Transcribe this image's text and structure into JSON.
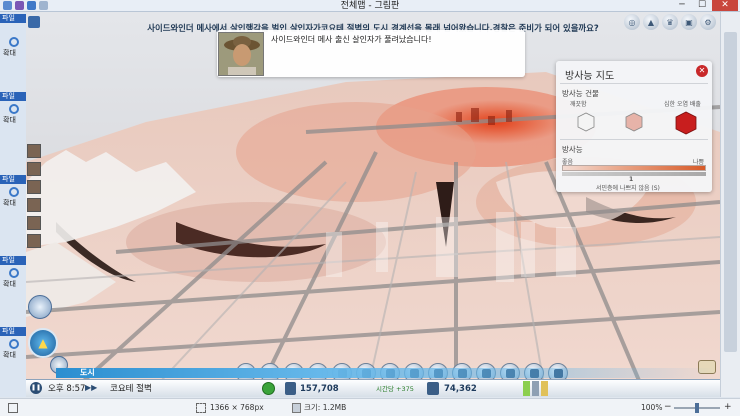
{
  "window": {
    "title": "전체맵 - 그림판",
    "controls": {
      "minimize": "─",
      "maximize": "☐",
      "close": "✕"
    }
  },
  "ribbons": [
    {
      "tab": "파일",
      "label": "확대"
    },
    {
      "tab": "파일",
      "label": "확대"
    },
    {
      "tab": "파일",
      "label": "확대"
    },
    {
      "tab": "파일",
      "label": "확대"
    },
    {
      "tab": "파일",
      "label": "확대"
    }
  ],
  "news": {
    "headline": "사이드와인더 메사에서 살인행각을 벌인 살인자가코요테 절벽의 도시 경계선을 몰래 넘어왔습니다.경찰은 준비가 되어 있을까요?",
    "popup_message": "사이드와인더 메사 출신 살인자가 풀려났습니다!"
  },
  "radiation_panel": {
    "title": "방사능 지도",
    "close_label": "✕",
    "building_section": "방사능 건물",
    "building_low": "깨끗함",
    "building_high": "심한 오염 배출",
    "level_section": "방사능",
    "level_good": "좋음",
    "level_bad": "나쁨",
    "cursor_value": "1",
    "hint": "서민층에 나쁘지 않음 (S)"
  },
  "hud": {
    "district": "도시",
    "time": "오후 8:57",
    "city_name": "코요테 절벽",
    "money": "157,708",
    "income": "시간당 +375",
    "population": "74,362"
  },
  "paint_status": {
    "dimensions": "1366 × 768px",
    "size": "크기: 1.2MB",
    "zoom": "100%"
  },
  "colors": {
    "accent": "#2a63b8",
    "radiation_high": "#d75a28",
    "radiation_low": "#f3dcd4",
    "money_green": "#3aa33a"
  }
}
